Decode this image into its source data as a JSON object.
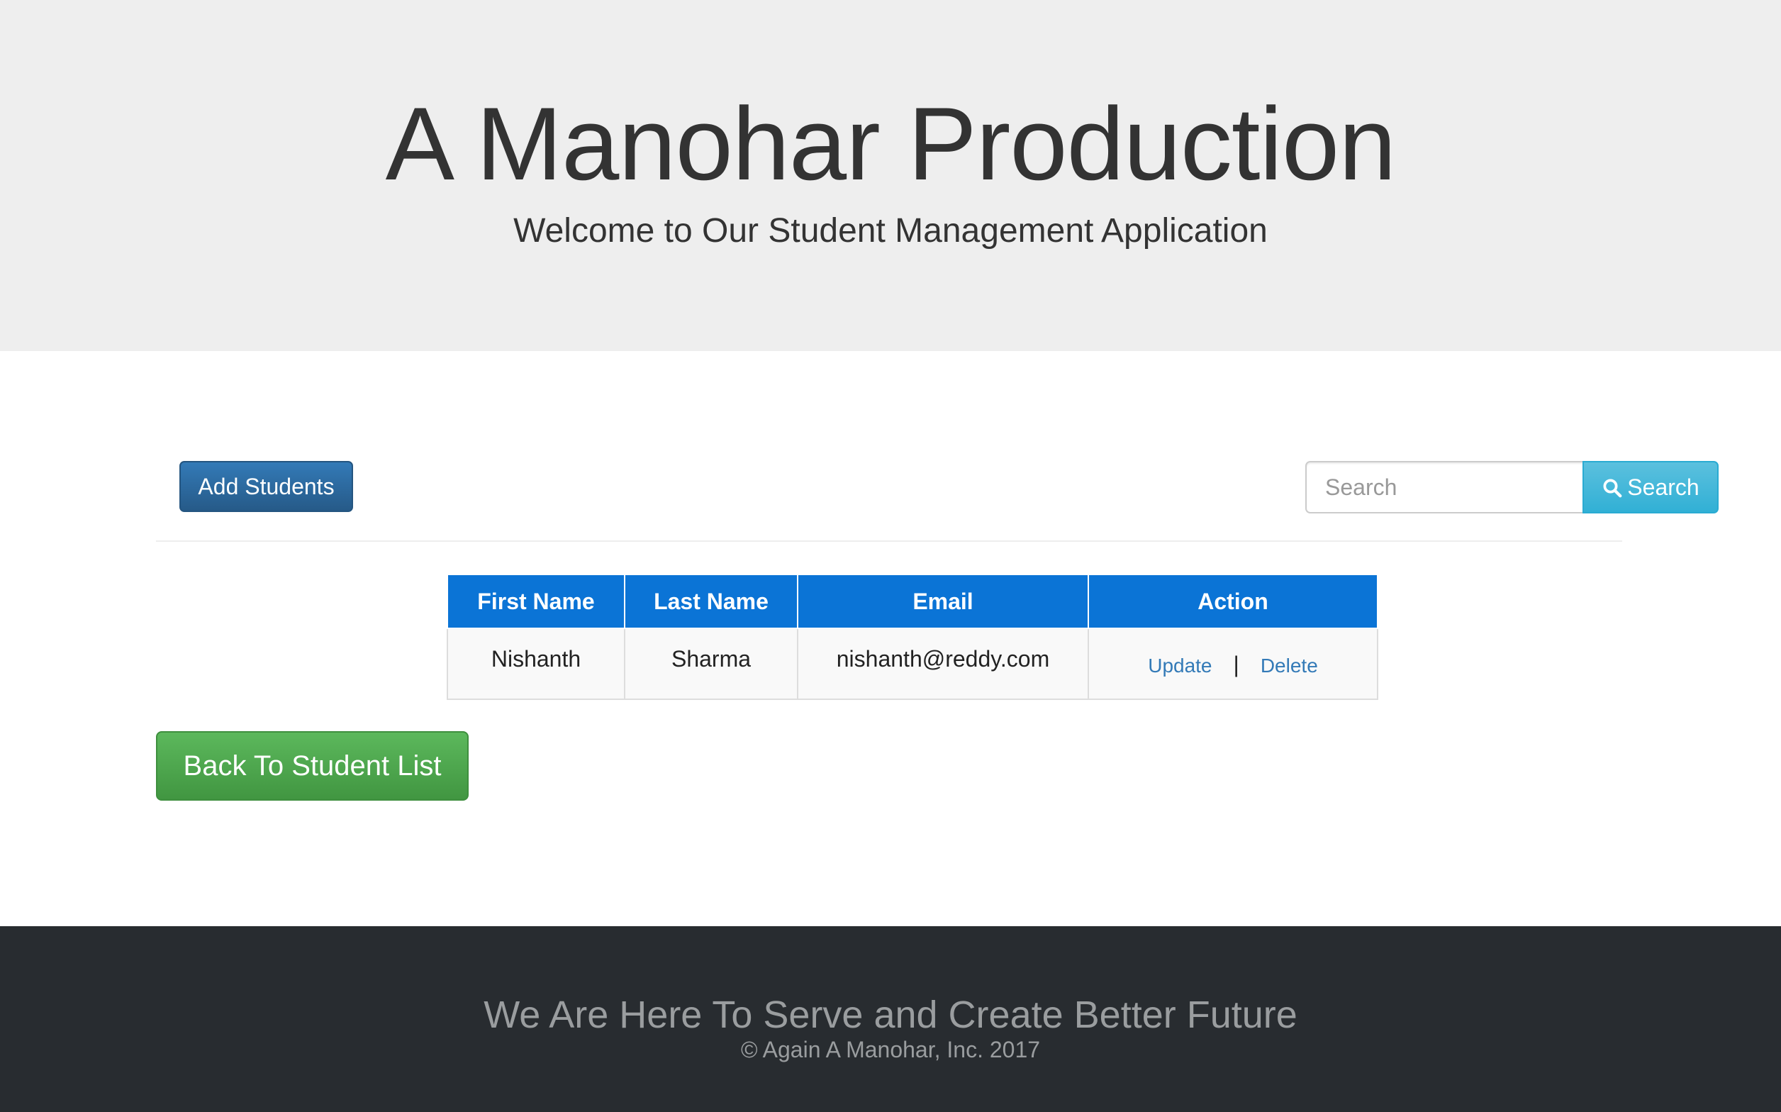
{
  "header": {
    "title": "A Manohar Production",
    "subtitle": "Welcome to Our Student Management Application"
  },
  "toolbar": {
    "add_label": "Add Students",
    "search_placeholder": "Search",
    "search_value": "",
    "search_button_label": "Search"
  },
  "table": {
    "headers": [
      "First Name",
      "Last Name",
      "Email",
      "Action"
    ],
    "rows": [
      {
        "first_name": "Nishanth",
        "last_name": "Sharma",
        "email": "nishanth@reddy.com",
        "update_label": "Update",
        "separator": "|",
        "delete_label": "Delete"
      }
    ]
  },
  "back_label": "Back To Student List",
  "footer": {
    "tagline": "We Are Here To Serve and Create Better Future",
    "copyright": "© Again A Manohar, Inc. 2017"
  },
  "colors": {
    "header_bg": "#eeeeee",
    "primary": "#337ab7",
    "info": "#5bc0de",
    "success": "#5cb85c",
    "table_header": "#0b74d6",
    "footer_bg": "#282c30"
  },
  "icons": {
    "search": "search-icon"
  }
}
